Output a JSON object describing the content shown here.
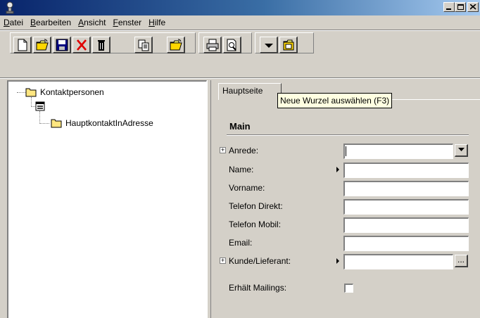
{
  "menu": [
    {
      "label": "Datei",
      "underline": "D",
      "rest": "atei"
    },
    {
      "label": "Bearbeiten",
      "underline": "B",
      "rest": "earbeiten"
    },
    {
      "label": "Ansicht",
      "underline": "A",
      "rest": "nsicht"
    },
    {
      "label": "Fenster",
      "underline": "F",
      "rest": "enster"
    },
    {
      "label": "Hilfe",
      "underline": "H",
      "rest": "ilfe"
    }
  ],
  "toolbar": {
    "buttons": [
      "new-document-icon",
      "open-folder-icon",
      "save-disk-icon",
      "delete-x-icon",
      "trash-icon",
      "copy-icon",
      "open-folder-icon",
      "print-icon",
      "print-preview-icon",
      "dropdown-arrow-icon",
      "select-root-icon"
    ]
  },
  "tree": {
    "root": "Kontaktpersonen",
    "child": "HauptkontaktInAdresse"
  },
  "tab": {
    "label": "Hauptseite"
  },
  "tooltip": {
    "text": "Neue Wurzel auswählen (F3)"
  },
  "form": {
    "section": "Main",
    "fields": {
      "anrede": {
        "label": "Anrede:",
        "value": ""
      },
      "name": {
        "label": "Name:",
        "value": ""
      },
      "vorname": {
        "label": "Vorname:",
        "value": ""
      },
      "telefon_direkt": {
        "label": "Telefon Direkt:",
        "value": ""
      },
      "telefon_mobil": {
        "label": "Telefon Mobil:",
        "value": ""
      },
      "email": {
        "label": "Email:",
        "value": ""
      },
      "kunde_lieferant": {
        "label": "Kunde/Lieferant:",
        "value": ""
      },
      "erhaelt_mailings": {
        "label": "Erhält Mailings:",
        "checked": false
      }
    },
    "more_button": "..."
  },
  "colors": {
    "titlebar_start": "#08246b",
    "titlebar_end": "#a6caf0",
    "face": "#d4d0c8",
    "tooltip": "#ffffe1"
  }
}
